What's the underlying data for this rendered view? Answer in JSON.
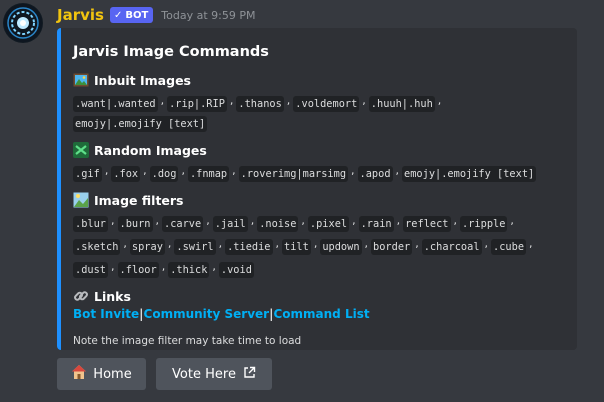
{
  "message": {
    "username": "Jarvis",
    "bot_tag": "BOT",
    "timestamp": "Today at 9:59 PM",
    "avatar_icon": "reactor-icon"
  },
  "embed": {
    "accent": "#1e90ff",
    "title": "Jarvis Image Commands",
    "fields": [
      {
        "name": "Inbuit Images",
        "icon": "framed-picture-icon",
        "tokens": [
          ".want|.wanted",
          ".rip|.RIP",
          ".thanos",
          ".voldemort",
          ".huuh|.huh",
          "emojy|.emojify [text]"
        ]
      },
      {
        "name": "Random Images",
        "icon": "shuffle-icon",
        "tokens": [
          ".gif",
          ".fox",
          ".dog",
          ".fnmap",
          ".roverimg|marsimg",
          ".apod",
          "emojy|.emojify [text]"
        ]
      },
      {
        "name": "Image filters",
        "icon": "image-filter-icon",
        "tokens": [
          ".blur",
          ".burn",
          ".carve",
          ".jail",
          ".noise",
          ".pixel",
          ".rain",
          "reflect",
          ".ripple",
          ".sketch",
          "spray",
          ".swirl",
          ".tiedie",
          "tilt",
          "updown",
          "border",
          ".charcoal",
          ".cube",
          ".dust",
          ".floor",
          ".thick",
          ".void"
        ]
      }
    ],
    "links_title": "Links",
    "links": [
      "Bot Invite",
      "Community Server",
      "Command List"
    ],
    "link_separator": "|",
    "footer": "Note the image filter may take time to load"
  },
  "buttons": {
    "home": {
      "label": "Home",
      "icon": "house-icon"
    },
    "vote": {
      "label": "Vote Here",
      "icon": "external-link-icon"
    }
  }
}
